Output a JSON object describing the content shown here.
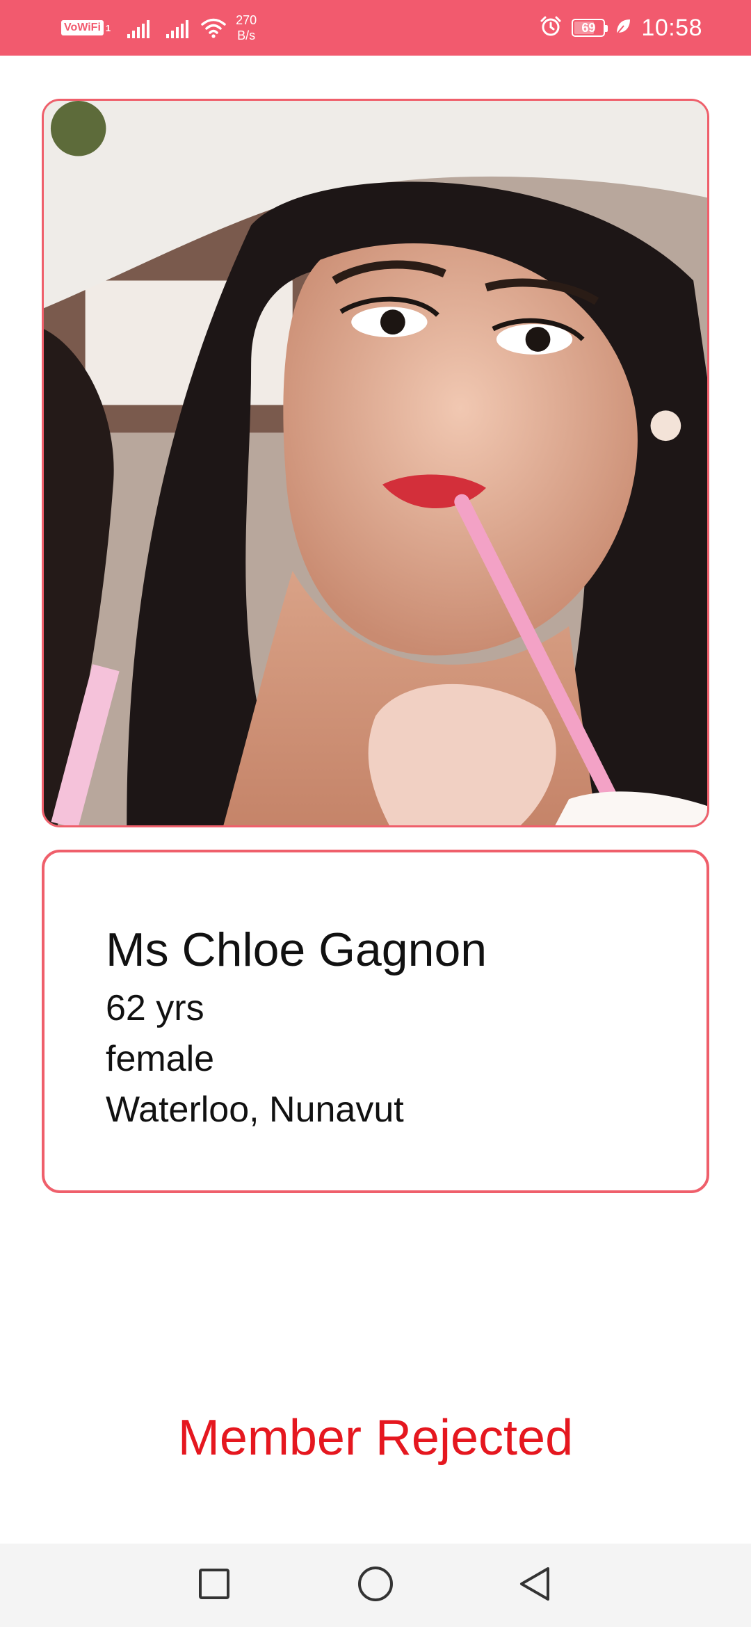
{
  "status_bar": {
    "vowifi_label": "VoWiFi",
    "vowifi_sub": "1",
    "net_speed_value": "270",
    "net_speed_unit": "B/s",
    "battery_level": "69",
    "battery_fraction": 0.69,
    "time": "10:58",
    "icons": [
      "vowifi-icon",
      "signal-icon",
      "signal-icon",
      "wifi-icon",
      "alarm-icon",
      "battery-icon",
      "leaf-icon"
    ],
    "background_color": "#f25a6e"
  },
  "profile": {
    "photo_icon": "profile-photo",
    "name": "Ms Chloe Gagnon",
    "age": "62 yrs",
    "gender": "female",
    "location": "Waterloo, Nunavut",
    "card_border_color": "#ef5f6b"
  },
  "status_message": {
    "text": "Member Rejected",
    "color": "#e5171f"
  },
  "nav_bar": {
    "icons": [
      "recent-apps-icon",
      "home-icon",
      "back-icon"
    ]
  }
}
